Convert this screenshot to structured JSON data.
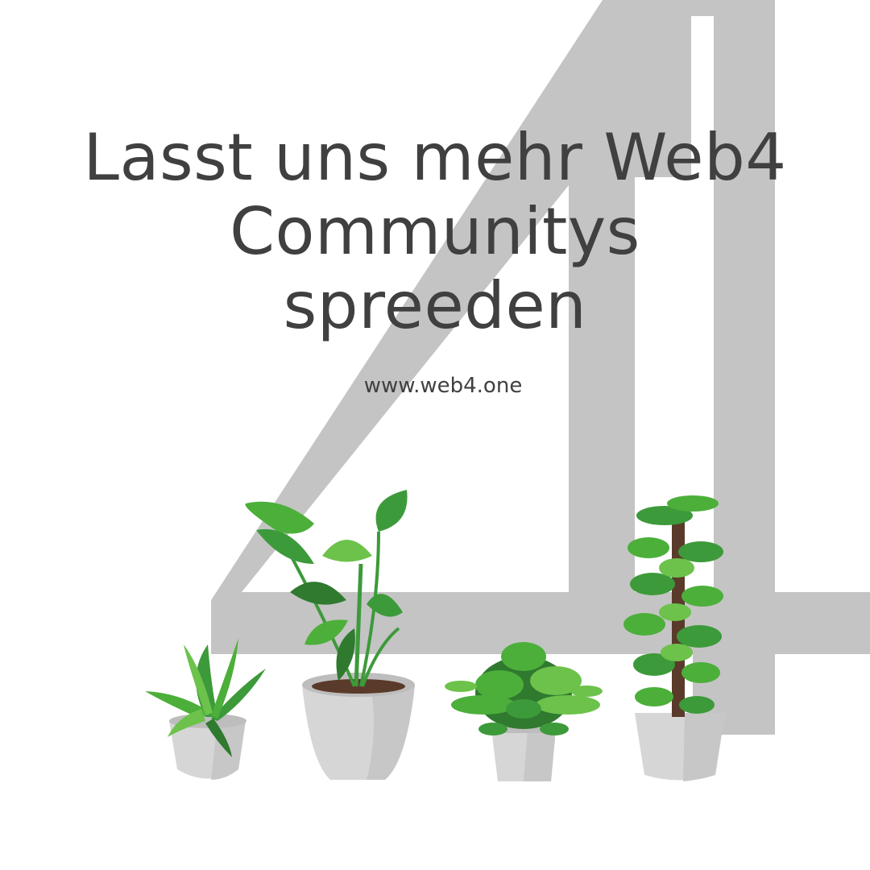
{
  "headline": {
    "line1": "Lasst uns mehr Web4",
    "line2": "Communitys",
    "line3": "spreeden"
  },
  "url": "www.web4.one",
  "decor": {
    "background_glyph": "digit-four-shape",
    "icons": [
      "aloe-plant-icon",
      "bird-of-paradise-plant-icon",
      "fern-plant-icon",
      "pothos-moss-pole-plant-icon"
    ]
  },
  "colors": {
    "background": "#ffffff",
    "text": "#404040",
    "four": "#c4c4c4",
    "leaf_dark": "#2f7a2f",
    "leaf_mid": "#3d9a3a",
    "leaf_light": "#6cc24a",
    "pot": "#d6d6d6",
    "pot_shade": "#bdbdbd"
  }
}
